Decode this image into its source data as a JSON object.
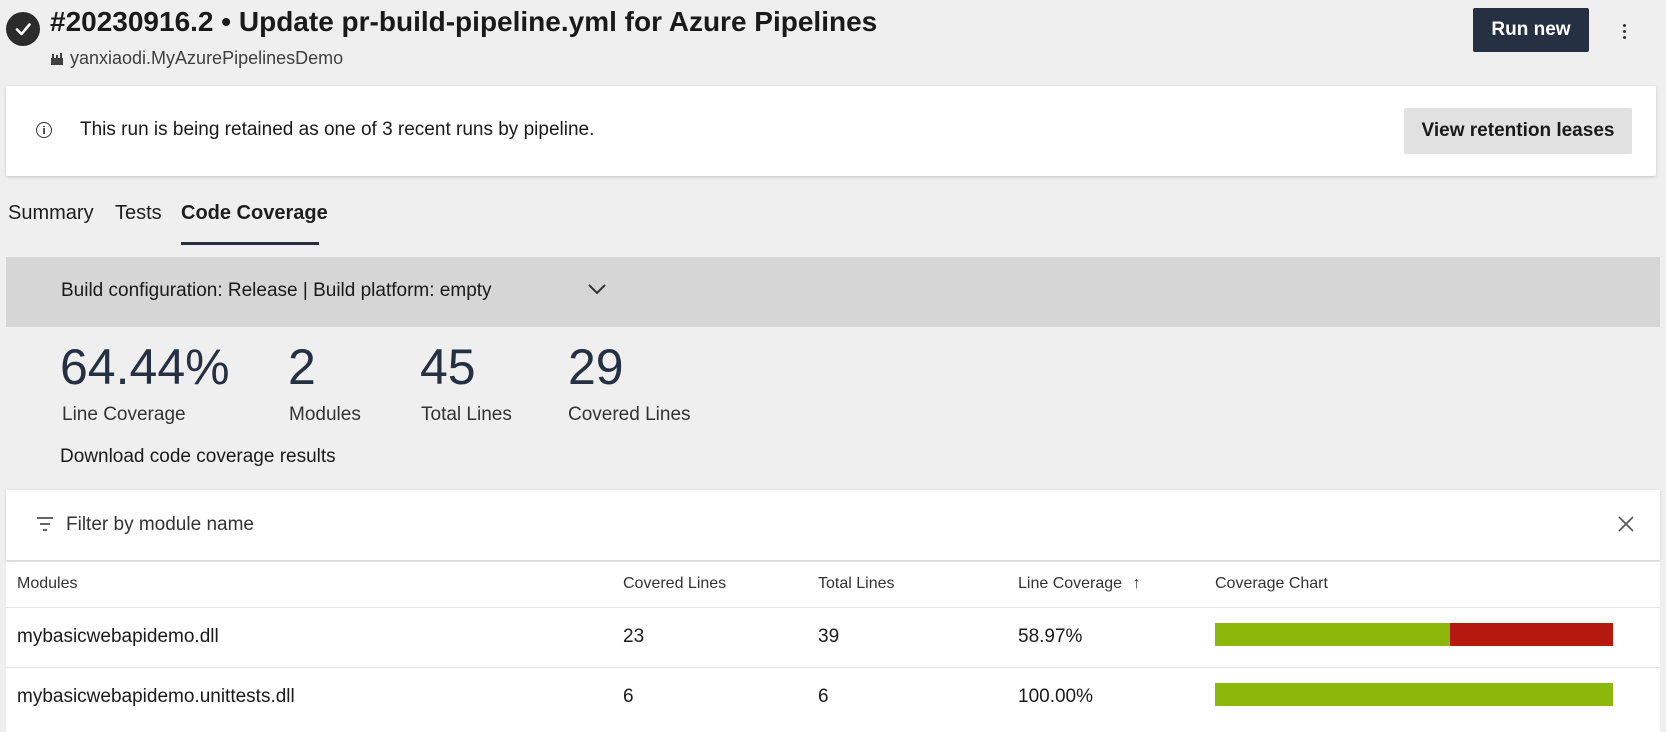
{
  "header": {
    "title": "#20230916.2 • Update pr-build-pipeline.yml for Azure Pipelines",
    "repo": "yanxiaodi.MyAzurePipelinesDemo",
    "run_new_label": "Run new",
    "status_icon": "check-circle-icon",
    "more_icon": "more-vertical-icon"
  },
  "banner": {
    "info_icon": "info-icon",
    "text": "This run is being retained as one of 3 recent runs by pipeline.",
    "button_label": "View retention leases"
  },
  "tabs": [
    {
      "label": "Summary",
      "active": false
    },
    {
      "label": "Tests",
      "active": false
    },
    {
      "label": "Code Coverage",
      "active": true
    }
  ],
  "config": {
    "text": "Build configuration: Release | Build platform: empty",
    "icon": "chevron-down-icon"
  },
  "stats": [
    {
      "value": "64.44%",
      "label": "Line Coverage"
    },
    {
      "value": "2",
      "label": "Modules"
    },
    {
      "value": "45",
      "label": "Total Lines"
    },
    {
      "value": "29",
      "label": "Covered Lines"
    }
  ],
  "download_label": "Download code coverage results",
  "filter": {
    "placeholder": "Filter by module name",
    "filter_icon": "filter-icon",
    "clear_icon": "close-icon"
  },
  "table": {
    "columns": [
      "Modules",
      "Covered Lines",
      "Total Lines",
      "Line Coverage",
      "Coverage Chart"
    ],
    "sort_indicator": "↑",
    "rows": [
      {
        "module": "mybasicwebapidemo.dll",
        "covered": "23",
        "total": "39",
        "coverage": "58.97%",
        "covered_fraction": 0.5897
      },
      {
        "module": "mybasicwebapidemo.unittests.dll",
        "covered": "6",
        "total": "6",
        "coverage": "100.00%",
        "covered_fraction": 1.0
      }
    ]
  },
  "colors": {
    "accent": "#253042",
    "covered": "#8cb809",
    "uncovered": "#b5180c"
  }
}
